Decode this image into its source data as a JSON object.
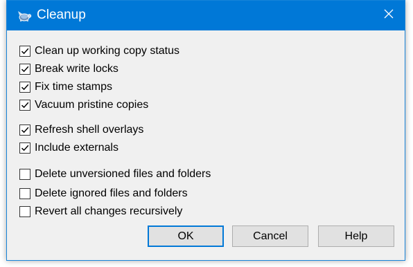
{
  "window": {
    "title": "Cleanup",
    "title_icon": "tortoisesvn-icon",
    "close_icon": "close-icon",
    "title_bar_color": "#0078d7"
  },
  "options": [
    {
      "label": "Clean up working copy status",
      "checked": true
    },
    {
      "label": "Break write locks",
      "checked": true
    },
    {
      "label": "Fix time stamps",
      "checked": true
    },
    {
      "label": "Vacuum pristine copies",
      "checked": true
    },
    {
      "label": "Refresh shell overlays",
      "checked": true
    },
    {
      "label": "Include externals",
      "checked": true
    },
    {
      "label": "Delete unversioned files and folders",
      "checked": false
    },
    {
      "label": "Delete ignored files and folders",
      "checked": false
    },
    {
      "label": "Revert all changes recursively",
      "checked": false
    }
  ],
  "buttons": {
    "ok": "OK",
    "cancel": "Cancel",
    "help": "Help"
  }
}
